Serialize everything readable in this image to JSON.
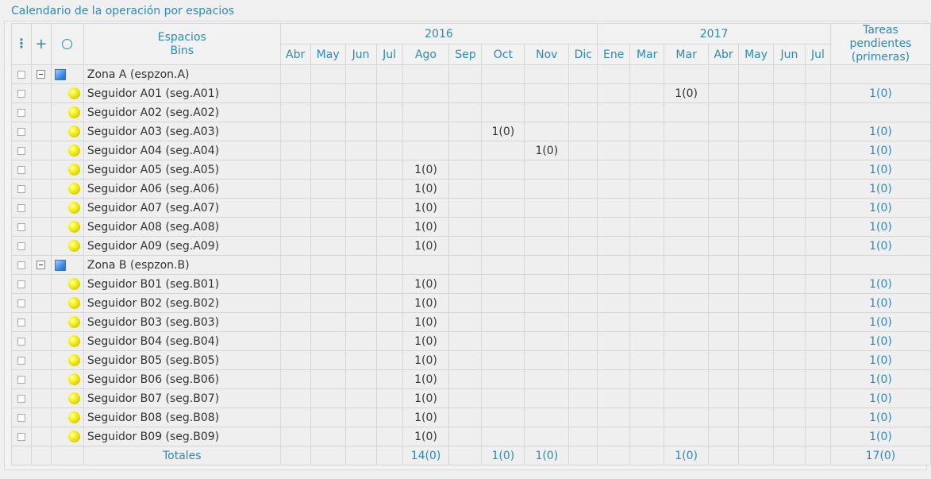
{
  "title": "Calendario de la operación por espacios",
  "header": {
    "col_spaces_line1": "Espacios",
    "col_spaces_line2": "Bins",
    "year_2016": "2016",
    "year_2017": "2017",
    "pending_line1": "Tareas",
    "pending_line2": "pendientes",
    "pending_line3": "(primeras)",
    "menu_icon": "vertical-dots-icon",
    "expand_icon": "plus-icon",
    "select_icon": "circle-icon"
  },
  "months": [
    "Abr",
    "May",
    "Jun",
    "Jul",
    "Ago",
    "Sep",
    "Oct",
    "Nov",
    "Dic",
    "Ene",
    "Mar",
    "Mar",
    "Abr",
    "May",
    "Jun",
    "Jul"
  ],
  "rows": [
    {
      "type": "zone",
      "name": "Zona A (espzon.A)",
      "cells": [
        "",
        "",
        "",
        "",
        "",
        "",
        "",
        "",
        "",
        "",
        "",
        "",
        "",
        "",
        "",
        ""
      ],
      "pending": ""
    },
    {
      "type": "item",
      "name": "Seguidor A01 (seg.A01)",
      "cells": [
        "",
        "",
        "",
        "",
        "",
        "",
        "",
        "",
        "",
        "",
        "",
        "1(0)",
        "",
        "",
        "",
        ""
      ],
      "pending": "1(0)"
    },
    {
      "type": "item",
      "name": "Seguidor A02 (seg.A02)",
      "cells": [
        "",
        "",
        "",
        "",
        "",
        "",
        "",
        "",
        "",
        "",
        "",
        "",
        "",
        "",
        "",
        ""
      ],
      "pending": ""
    },
    {
      "type": "item",
      "name": "Seguidor A03 (seg.A03)",
      "cells": [
        "",
        "",
        "",
        "",
        "",
        "",
        "1(0)",
        "",
        "",
        "",
        "",
        "",
        "",
        "",
        "",
        ""
      ],
      "pending": "1(0)"
    },
    {
      "type": "item",
      "name": "Seguidor A04 (seg.A04)",
      "cells": [
        "",
        "",
        "",
        "",
        "",
        "",
        "",
        "1(0)",
        "",
        "",
        "",
        "",
        "",
        "",
        "",
        ""
      ],
      "pending": "1(0)"
    },
    {
      "type": "item",
      "name": "Seguidor A05 (seg.A05)",
      "cells": [
        "",
        "",
        "",
        "",
        "1(0)",
        "",
        "",
        "",
        "",
        "",
        "",
        "",
        "",
        "",
        "",
        ""
      ],
      "pending": "1(0)"
    },
    {
      "type": "item",
      "name": "Seguidor A06 (seg.A06)",
      "cells": [
        "",
        "",
        "",
        "",
        "1(0)",
        "",
        "",
        "",
        "",
        "",
        "",
        "",
        "",
        "",
        "",
        ""
      ],
      "pending": "1(0)"
    },
    {
      "type": "item",
      "name": "Seguidor A07 (seg.A07)",
      "cells": [
        "",
        "",
        "",
        "",
        "1(0)",
        "",
        "",
        "",
        "",
        "",
        "",
        "",
        "",
        "",
        "",
        ""
      ],
      "pending": "1(0)"
    },
    {
      "type": "item",
      "name": "Seguidor A08 (seg.A08)",
      "cells": [
        "",
        "",
        "",
        "",
        "1(0)",
        "",
        "",
        "",
        "",
        "",
        "",
        "",
        "",
        "",
        "",
        ""
      ],
      "pending": "1(0)"
    },
    {
      "type": "item",
      "name": "Seguidor A09 (seg.A09)",
      "cells": [
        "",
        "",
        "",
        "",
        "1(0)",
        "",
        "",
        "",
        "",
        "",
        "",
        "",
        "",
        "",
        "",
        ""
      ],
      "pending": "1(0)"
    },
    {
      "type": "zone",
      "name": "Zona B (espzon.B)",
      "cells": [
        "",
        "",
        "",
        "",
        "",
        "",
        "",
        "",
        "",
        "",
        "",
        "",
        "",
        "",
        "",
        ""
      ],
      "pending": ""
    },
    {
      "type": "item",
      "name": "Seguidor B01 (seg.B01)",
      "cells": [
        "",
        "",
        "",
        "",
        "1(0)",
        "",
        "",
        "",
        "",
        "",
        "",
        "",
        "",
        "",
        "",
        ""
      ],
      "pending": "1(0)"
    },
    {
      "type": "item",
      "name": "Seguidor B02 (seg.B02)",
      "cells": [
        "",
        "",
        "",
        "",
        "1(0)",
        "",
        "",
        "",
        "",
        "",
        "",
        "",
        "",
        "",
        "",
        ""
      ],
      "pending": "1(0)"
    },
    {
      "type": "item",
      "name": "Seguidor B03 (seg.B03)",
      "cells": [
        "",
        "",
        "",
        "",
        "1(0)",
        "",
        "",
        "",
        "",
        "",
        "",
        "",
        "",
        "",
        "",
        ""
      ],
      "pending": "1(0)"
    },
    {
      "type": "item",
      "name": "Seguidor B04 (seg.B04)",
      "cells": [
        "",
        "",
        "",
        "",
        "1(0)",
        "",
        "",
        "",
        "",
        "",
        "",
        "",
        "",
        "",
        "",
        ""
      ],
      "pending": "1(0)"
    },
    {
      "type": "item",
      "name": "Seguidor B05 (seg.B05)",
      "cells": [
        "",
        "",
        "",
        "",
        "1(0)",
        "",
        "",
        "",
        "",
        "",
        "",
        "",
        "",
        "",
        "",
        ""
      ],
      "pending": "1(0)"
    },
    {
      "type": "item",
      "name": "Seguidor B06 (seg.B06)",
      "cells": [
        "",
        "",
        "",
        "",
        "1(0)",
        "",
        "",
        "",
        "",
        "",
        "",
        "",
        "",
        "",
        "",
        ""
      ],
      "pending": "1(0)"
    },
    {
      "type": "item",
      "name": "Seguidor B07 (seg.B07)",
      "cells": [
        "",
        "",
        "",
        "",
        "1(0)",
        "",
        "",
        "",
        "",
        "",
        "",
        "",
        "",
        "",
        "",
        ""
      ],
      "pending": "1(0)"
    },
    {
      "type": "item",
      "name": "Seguidor B08 (seg.B08)",
      "cells": [
        "",
        "",
        "",
        "",
        "1(0)",
        "",
        "",
        "",
        "",
        "",
        "",
        "",
        "",
        "",
        "",
        ""
      ],
      "pending": "1(0)"
    },
    {
      "type": "item",
      "name": "Seguidor B09 (seg.B09)",
      "cells": [
        "",
        "",
        "",
        "",
        "1(0)",
        "",
        "",
        "",
        "",
        "",
        "",
        "",
        "",
        "",
        "",
        ""
      ],
      "pending": "1(0)"
    }
  ],
  "totals": {
    "label": "Totales",
    "cells": [
      "",
      "",
      "",
      "",
      "14(0)",
      "",
      "1(0)",
      "1(0)",
      "",
      "",
      "",
      "1(0)",
      "",
      "",
      "",
      ""
    ],
    "pending": "17(0)"
  },
  "colors": {
    "accent": "#2a8ab8",
    "zone_icon": "#3f8ce8",
    "item_icon": "#f2ee1a"
  }
}
